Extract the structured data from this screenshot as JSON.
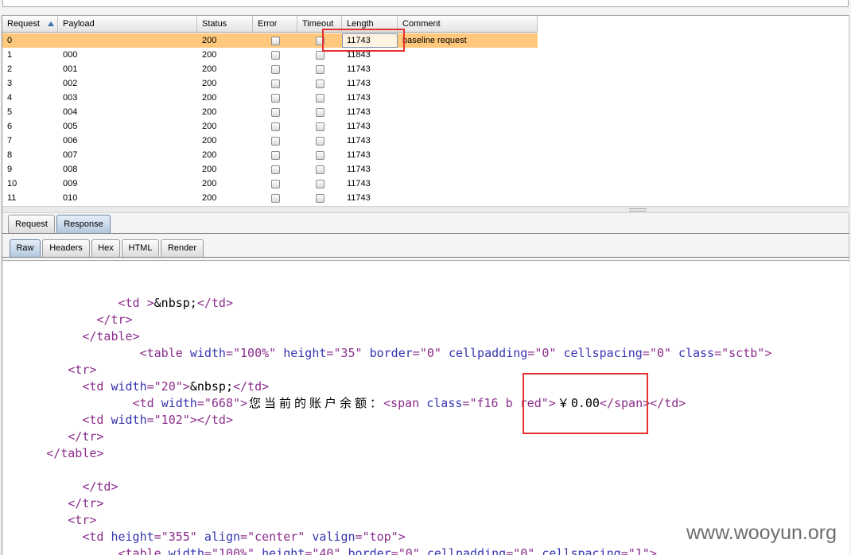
{
  "colors": {
    "selected_row": "#ffc87c",
    "annotation_box": "#e5312e",
    "syntax_tag": "#8b2d8b",
    "syntax_attribute": "#3535b0",
    "syntax_value": "#8b2d8b",
    "active_tab": "#b3c8de"
  },
  "results_table": {
    "columns": [
      "Request",
      "Payload",
      "Status",
      "Error",
      "Timeout",
      "Length",
      "Comment"
    ],
    "sort_column_index": 0,
    "sort_icon": "sort-ascending-icon",
    "focused_cell": {
      "row": 0,
      "column": 5
    },
    "rows": [
      {
        "request": "0",
        "payload": "",
        "status": "200",
        "error": false,
        "timeout": false,
        "length": "11743",
        "comment": "baseline request",
        "selected": true
      },
      {
        "request": "1",
        "payload": "000",
        "status": "200",
        "error": false,
        "timeout": false,
        "length": "11843",
        "comment": "",
        "selected": false
      },
      {
        "request": "2",
        "payload": "001",
        "status": "200",
        "error": false,
        "timeout": false,
        "length": "11743",
        "comment": "",
        "selected": false
      },
      {
        "request": "3",
        "payload": "002",
        "status": "200",
        "error": false,
        "timeout": false,
        "length": "11743",
        "comment": "",
        "selected": false
      },
      {
        "request": "4",
        "payload": "003",
        "status": "200",
        "error": false,
        "timeout": false,
        "length": "11743",
        "comment": "",
        "selected": false
      },
      {
        "request": "5",
        "payload": "004",
        "status": "200",
        "error": false,
        "timeout": false,
        "length": "11743",
        "comment": "",
        "selected": false
      },
      {
        "request": "6",
        "payload": "005",
        "status": "200",
        "error": false,
        "timeout": false,
        "length": "11743",
        "comment": "",
        "selected": false
      },
      {
        "request": "7",
        "payload": "006",
        "status": "200",
        "error": false,
        "timeout": false,
        "length": "11743",
        "comment": "",
        "selected": false
      },
      {
        "request": "8",
        "payload": "007",
        "status": "200",
        "error": false,
        "timeout": false,
        "length": "11743",
        "comment": "",
        "selected": false
      },
      {
        "request": "9",
        "payload": "008",
        "status": "200",
        "error": false,
        "timeout": false,
        "length": "11743",
        "comment": "",
        "selected": false
      },
      {
        "request": "10",
        "payload": "009",
        "status": "200",
        "error": false,
        "timeout": false,
        "length": "11743",
        "comment": "",
        "selected": false
      },
      {
        "request": "11",
        "payload": "010",
        "status": "200",
        "error": false,
        "timeout": false,
        "length": "11743",
        "comment": "",
        "selected": false
      }
    ]
  },
  "message_tabs": [
    {
      "label": "Request",
      "active": false
    },
    {
      "label": "Response",
      "active": true
    }
  ],
  "view_tabs": [
    {
      "label": "Raw",
      "active": true
    },
    {
      "label": "Headers",
      "active": false
    },
    {
      "label": "Hex",
      "active": false
    },
    {
      "label": "HTML",
      "active": false
    },
    {
      "label": "Render",
      "active": false
    }
  ],
  "response": {
    "raw_lines": [
      "",
      "",
      "                <td >&nbsp;</td>",
      "             </tr>",
      "           </table>",
      "                   <table width=\"100%\" height=\"35\" border=\"0\" cellpadding=\"0\" cellspacing=\"0\" class=\"sctb\">",
      "         <tr>",
      "           <td width=\"20\">&nbsp;</td>",
      "                  <td width=\"668\">您当前的账户余额：<span class=\"f16 b red\">￥0.00</span></td>",
      "           <td width=\"102\"></td>",
      "         </tr>",
      "      </table>",
      "",
      "           </td>",
      "         </tr>",
      "         <tr>",
      "           <td height=\"355\" align=\"center\" valign=\"top\">",
      "                <table width=\"100%\" height=\"40\" border=\"0\" cellpadding=\"0\" cellspacing=\"1\">"
    ]
  },
  "watermark": "www.wooyun.org"
}
